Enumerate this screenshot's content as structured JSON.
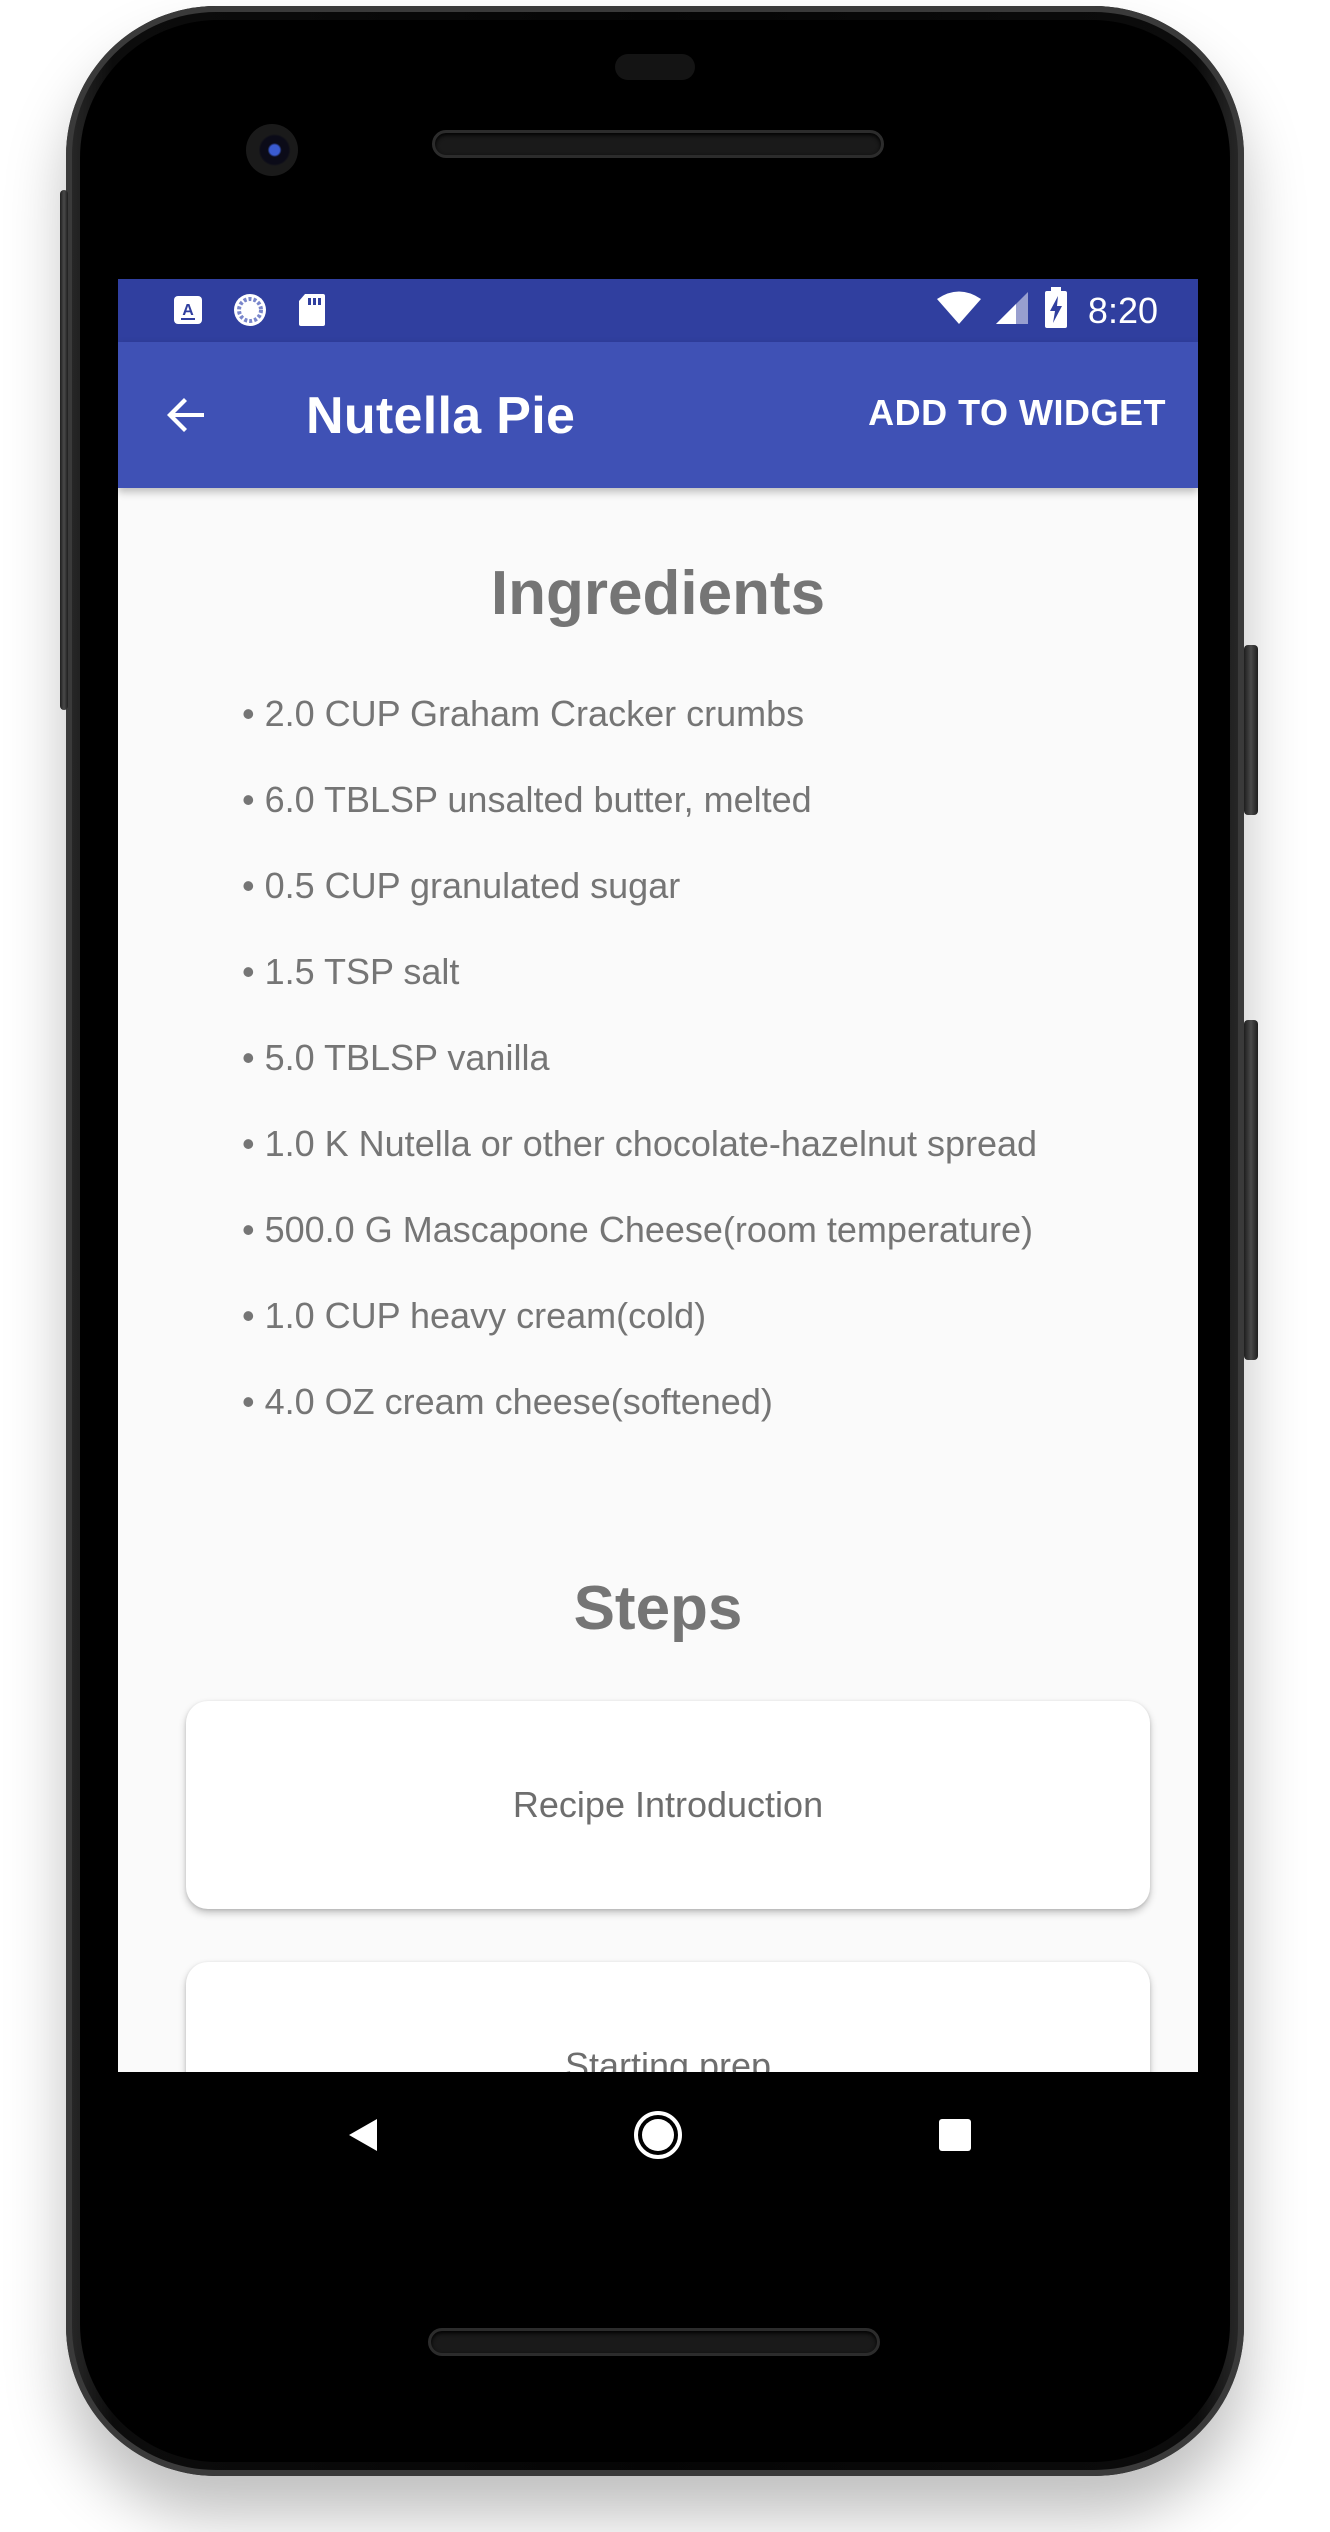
{
  "status_bar": {
    "time": "8:20",
    "left_icons": [
      "keyboard-a-icon",
      "sync-circle-icon",
      "sd-card-icon"
    ],
    "right_icons": [
      "wifi-icon",
      "cell-signal-icon",
      "battery-charging-icon"
    ]
  },
  "app_bar": {
    "title": "Nutella Pie",
    "action_label": "ADD TO WIDGET",
    "back_icon": "arrow-back-icon",
    "color": "#3f51b5",
    "status_color": "#303f9f"
  },
  "ingredients": {
    "heading": "Ingredients",
    "items": [
      "• 2.0 CUP Graham Cracker crumbs",
      "• 6.0 TBLSP unsalted butter, melted",
      "• 0.5 CUP granulated sugar",
      "• 1.5 TSP salt",
      "• 5.0 TBLSP vanilla",
      "• 1.0 K Nutella or other chocolate-hazelnut spread",
      "• 500.0 G Mascapone Cheese(room temperature)",
      "• 1.0 CUP heavy cream(cold)",
      "• 4.0 OZ cream cheese(softened)"
    ]
  },
  "steps": {
    "heading": "Steps",
    "items": [
      "Recipe Introduction",
      "Starting prep"
    ]
  },
  "nav_bar": {
    "buttons": [
      "back-triangle-icon",
      "home-circle-icon",
      "recents-square-icon"
    ]
  }
}
